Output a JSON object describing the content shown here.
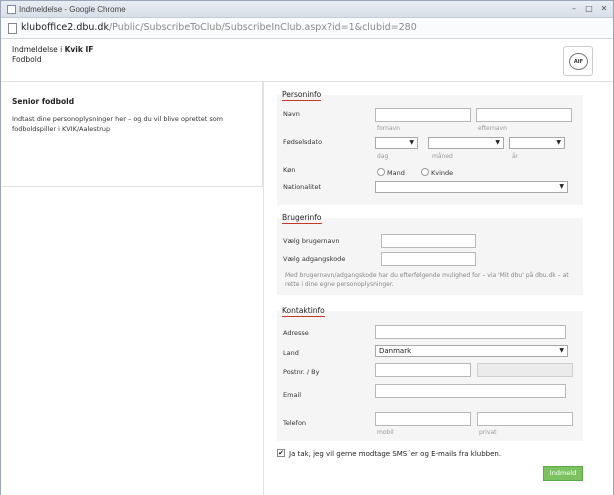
{
  "browser": {
    "title": "Indmeldelse - Google Chrome",
    "url_host": "kluboffice2.dbu.dk",
    "url_path": "/Public/SubscribeToClub/SubscribeInClub.aspx?id=1&clubid=280",
    "controls": {
      "minimize": "–",
      "maximize": "□",
      "close": "✕"
    }
  },
  "header": {
    "prefix": "Indmeldelse i",
    "club": "Kvik IF",
    "sport": "Fodbold",
    "logo_text": "AIF"
  },
  "intro": {
    "title": "Senior fodbold",
    "text": "Indtast dine personoplysninger her – og du vil blive oprettet som fodboldspiller i KVIK/Aalestrup"
  },
  "personinfo": {
    "legend": "Personinfo",
    "name_label": "Navn",
    "firstname_sub": "fornavn",
    "lastname_sub": "efternavn",
    "dob_label": "Fødselsdato",
    "day_sub": "dag",
    "month_sub": "måned",
    "year_sub": "år",
    "gender_label": "Køn",
    "gender_male": "Mand",
    "gender_female": "Kvinde",
    "nationality_label": "Nationalitet"
  },
  "brugerinfo": {
    "legend": "Brugerinfo",
    "username_label": "Vælg brugernavn",
    "password_label": "Vælg adgangskode",
    "note": "Med brugernavn/adgangskode har du efterfølgende mulighed for – via 'Mit dbu' på dbu.dk – at rette i dine egne personoplysninger."
  },
  "kontaktinfo": {
    "legend": "Kontaktinfo",
    "address_label": "Adresse",
    "country_label": "Land",
    "country_value": "Danmark",
    "postal_label": "Postnr. / By",
    "email_label": "Email",
    "phone_label": "Telefon",
    "mobile_sub": "mobil",
    "private_sub": "privat"
  },
  "consent": {
    "checked_mark": "✔",
    "label": "Ja tak, jeg vil gerne modtage SMS´er og E-mails fra klubben."
  },
  "submit": {
    "label": "Indmeld"
  }
}
